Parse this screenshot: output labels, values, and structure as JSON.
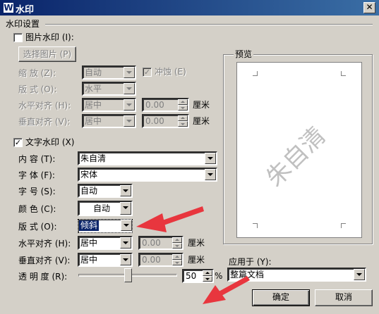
{
  "window": {
    "title": "水印",
    "app_icon": "W"
  },
  "section_title": "水印设置",
  "picture": {
    "checkbox_label": "图片水印 (I):",
    "checked": false,
    "select_button": "选择图片 (P)",
    "scale_label": "缩    放 (Z):",
    "scale_value": "自动",
    "washout_label": "冲蚀 (E)",
    "washout_checked": true,
    "layout_label": "版    式 (O):",
    "layout_value": "水平",
    "halign_label": "水平对齐 (H):",
    "halign_value": "居中",
    "halign_offset": "0.00",
    "valign_label": "垂直对齐 (V):",
    "valign_value": "居中",
    "valign_offset": "0.00",
    "unit": "厘米"
  },
  "text": {
    "checkbox_label": "文字水印 (X)",
    "checked": true,
    "content_label": "内    容 (T):",
    "content_value": "朱自清",
    "font_label": "字    体 (F):",
    "font_value": "宋体",
    "size_label": "字    号 (S):",
    "size_value": "自动",
    "color_label": "颜    色 (C):",
    "color_value": "自动",
    "layout_label": "版    式 (O):",
    "layout_value": "倾斜",
    "halign_label": "水平对齐 (H):",
    "halign_value": "居中",
    "halign_offset": "0.00",
    "valign_label": "垂直对齐 (V):",
    "valign_value": "居中",
    "valign_offset": "0.00",
    "unit": "厘米",
    "transparency_label": "透  明  度 (R):",
    "transparency_value": "50",
    "transparency_unit": "%",
    "transparency_level": 0.5
  },
  "preview": {
    "title": "预览",
    "watermark_text": "朱自清"
  },
  "apply": {
    "label": "应用于 (Y):",
    "value": "整篇文档"
  },
  "buttons": {
    "ok": "确定",
    "cancel": "取消"
  },
  "colors": {
    "titlebar_start": "#0a246a",
    "titlebar_end": "#3a6ea5",
    "arrow": "#e8363e",
    "selection": "#0a246a"
  }
}
